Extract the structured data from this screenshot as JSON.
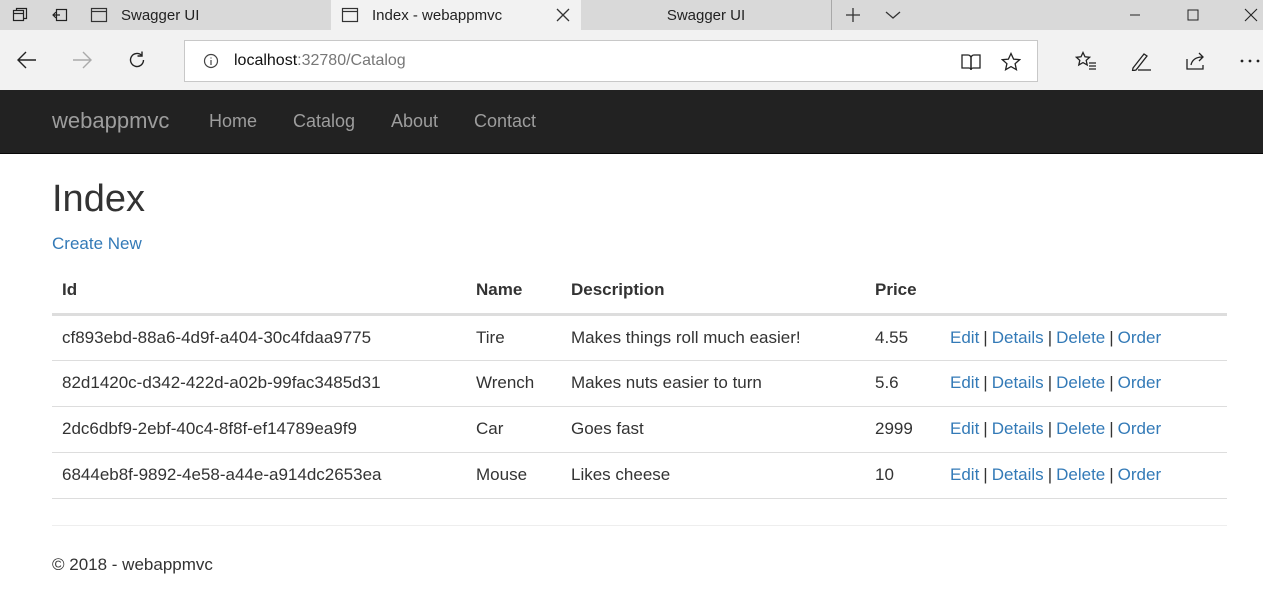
{
  "browser": {
    "tabs": [
      {
        "title": "Swagger UI"
      },
      {
        "title": "Index - webappmvc"
      },
      {
        "title": "Swagger UI"
      }
    ],
    "address": {
      "host": "localhost",
      "rest": ":32780/Catalog"
    }
  },
  "site": {
    "brand": "webappmvc",
    "nav": [
      {
        "label": "Home"
      },
      {
        "label": "Catalog"
      },
      {
        "label": "About"
      },
      {
        "label": "Contact"
      }
    ]
  },
  "page": {
    "title": "Index",
    "create_new": "Create New",
    "columns": [
      "Id",
      "Name",
      "Description",
      "Price"
    ],
    "rows": [
      {
        "id": "cf893ebd-88a6-4d9f-a404-30c4fdaa9775",
        "name": "Tire",
        "description": "Makes things roll much easier!",
        "price": "4.55"
      },
      {
        "id": "82d1420c-d342-422d-a02b-99fac3485d31",
        "name": "Wrench",
        "description": "Makes nuts easier to turn",
        "price": "5.6"
      },
      {
        "id": "2dc6dbf9-2ebf-40c4-8f8f-ef14789ea9f9",
        "name": "Car",
        "description": "Goes fast",
        "price": "2999"
      },
      {
        "id": "6844eb8f-9892-4e58-a44e-a914dc2653ea",
        "name": "Mouse",
        "description": "Likes cheese",
        "price": "10"
      }
    ],
    "actions": {
      "edit": "Edit",
      "details": "Details",
      "delete": "Delete",
      "order": "Order",
      "separator": "|"
    }
  },
  "footer": {
    "text": "© 2018 - webappmvc"
  },
  "colors": {
    "navbar": "#222222",
    "link": "#337ab7",
    "nav_text": "#9d9d9d"
  }
}
